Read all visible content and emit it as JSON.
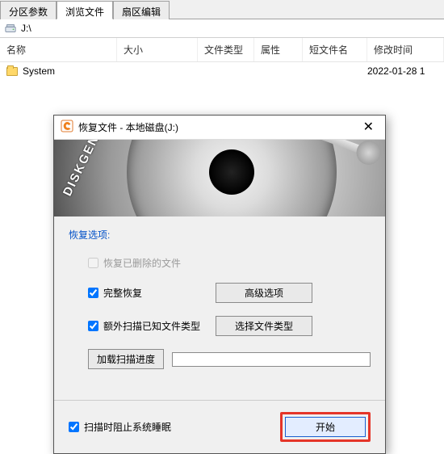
{
  "tabs": {
    "partition": "分区参数",
    "browse": "浏览文件",
    "sector": "扇区编辑"
  },
  "path": "J:\\",
  "columns": {
    "name": "名称",
    "size": "大小",
    "type": "文件类型",
    "attr": "属性",
    "short": "短文件名",
    "mtime": "修改时间"
  },
  "rows": [
    {
      "name": "System",
      "mtime": "2022-01-28 1"
    }
  ],
  "dialog": {
    "title": "恢复文件 - 本地磁盘(J:)",
    "banner_brand": "DISKGENIUS",
    "section_label": "恢复选项:",
    "opt_recover_deleted": {
      "label": "恢复已删除的文件",
      "checked": false,
      "enabled": false
    },
    "opt_full_recover": {
      "label": "完整恢复",
      "checked": true
    },
    "btn_advanced": "高级选项",
    "opt_extra_scan": {
      "label": "额外扫描已知文件类型",
      "checked": true
    },
    "btn_select_types": "选择文件类型",
    "btn_load_progress": "加载扫描进度",
    "footer": {
      "opt_prevent_sleep": {
        "label": "扫描时阻止系统睡眠",
        "checked": true
      },
      "btn_start": "开始"
    }
  }
}
